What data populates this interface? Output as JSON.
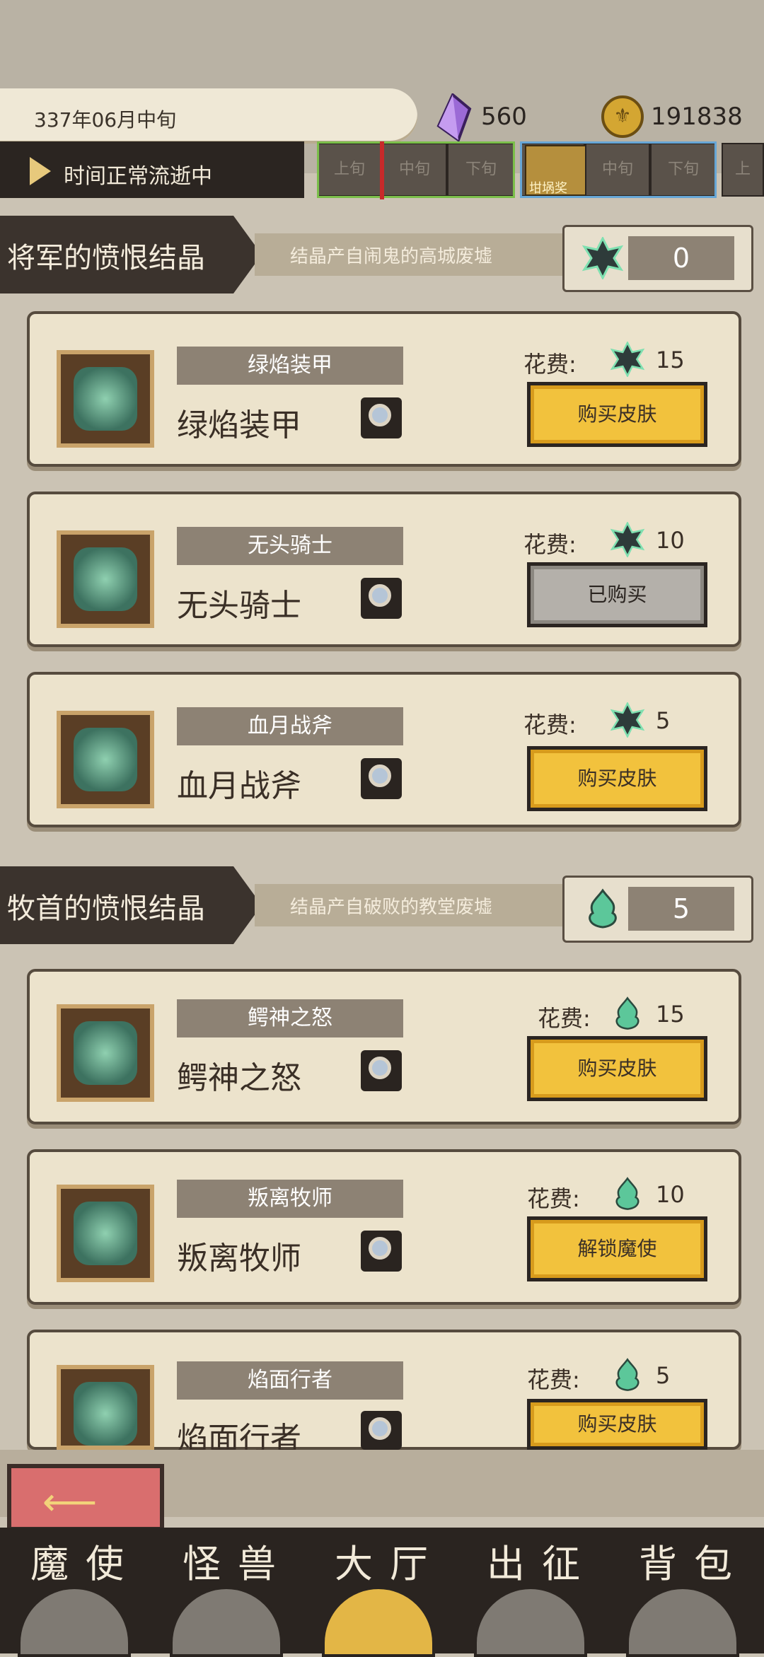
{
  "header": {
    "date": "337年06月中旬",
    "crystals": "560",
    "coins": "191838",
    "coin_symbol": "⚜",
    "time_status": "时间正常流逝中",
    "segments_a": [
      "上旬",
      "中旬",
      "下旬"
    ],
    "segments_b": [
      "坩埚奖",
      "中旬",
      "下旬"
    ],
    "segment_c": "上"
  },
  "sections": [
    {
      "title": "将军的愤恨结晶",
      "desc": "结晶产自闹鬼的高城废墟",
      "stock": "0",
      "items": [
        {
          "tag": "绿焰装甲",
          "name": "绿焰装甲",
          "cost_label": "花费:",
          "cost": "15",
          "button": "购买皮肤",
          "state": "buy"
        },
        {
          "tag": "无头骑士",
          "name": "无头骑士",
          "cost_label": "花费:",
          "cost": "10",
          "button": "已购买",
          "state": "bought"
        },
        {
          "tag": "血月战斧",
          "name": "血月战斧",
          "cost_label": "花费:",
          "cost": "5",
          "button": "购买皮肤",
          "state": "buy"
        }
      ]
    },
    {
      "title": "牧首的愤恨结晶",
      "desc": "结晶产自破败的教堂废墟",
      "stock": "5",
      "items": [
        {
          "tag": "鳄神之怒",
          "name": "鳄神之怒",
          "cost_label": "花费:",
          "cost": "15",
          "button": "购买皮肤",
          "state": "buy"
        },
        {
          "tag": "叛离牧师",
          "name": "叛离牧师",
          "cost_label": "花费:",
          "cost": "10",
          "button": "解锁魔使",
          "state": "buy"
        },
        {
          "tag": "焰面行者",
          "name": "焰面行者",
          "cost_label": "花费:",
          "cost": "5",
          "button": "购买皮肤",
          "state": "buy"
        }
      ]
    }
  ],
  "nav": [
    "魔使",
    "怪兽",
    "大厅",
    "出征",
    "背包"
  ]
}
